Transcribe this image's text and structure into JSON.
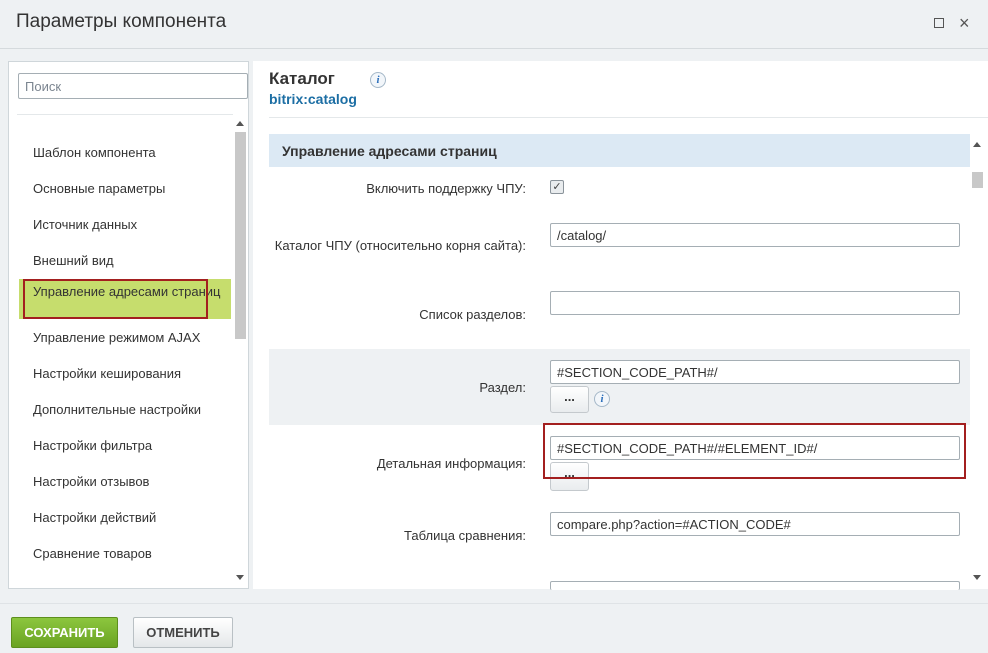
{
  "window": {
    "title": "Параметры компонента",
    "maximize_icon": "maximize-icon",
    "close_icon": "close-icon",
    "close_glyph": "×"
  },
  "sidebar": {
    "search_placeholder": "Поиск",
    "items": [
      {
        "label": "Шаблон компонента",
        "active": false
      },
      {
        "label": "Основные параметры",
        "active": false
      },
      {
        "label": "Источник данных",
        "active": false
      },
      {
        "label": "Внешний вид",
        "active": false
      },
      {
        "label": "Управление адресами страниц",
        "active": true
      },
      {
        "label": "Управление режимом AJAX",
        "active": false
      },
      {
        "label": "Настройки кеширования",
        "active": false
      },
      {
        "label": "Дополнительные настройки",
        "active": false
      },
      {
        "label": "Настройки фильтра",
        "active": false
      },
      {
        "label": "Настройки отзывов",
        "active": false
      },
      {
        "label": "Настройки действий",
        "active": false
      },
      {
        "label": "Сравнение товаров",
        "active": false
      }
    ]
  },
  "component": {
    "title": "Каталог",
    "code": "bitrix:catalog",
    "info_icon": "i"
  },
  "section": {
    "title": "Управление адресами страниц",
    "fields": [
      {
        "label": "Включить поддержку ЧПУ:",
        "type": "checkbox",
        "checked": true,
        "check_glyph": "✓"
      },
      {
        "label": "Каталог ЧПУ (относительно корня сайта):",
        "type": "text",
        "value": "/catalog/"
      },
      {
        "label": "Список разделов:",
        "type": "text",
        "value": ""
      },
      {
        "label": "Раздел:",
        "type": "text",
        "value": "#SECTION_CODE_PATH#/",
        "button": "...",
        "info": "i"
      },
      {
        "label": "Детальная информация:",
        "type": "text",
        "value": "#SECTION_CODE_PATH#/#ELEMENT_ID#/",
        "button": "..."
      },
      {
        "label": "Таблица сравнения:",
        "type": "text",
        "value": "compare.php?action=#ACTION_CODE#"
      }
    ]
  },
  "footer": {
    "save_label": "СОХРАНИТЬ",
    "cancel_label": "ОТМЕНИТЬ"
  },
  "colors": {
    "accent_green": "#7ab62f",
    "active_item_bg": "#c6dd6d",
    "highlight_border": "#a31f1f",
    "section_header_bg": "#dce9f4",
    "link_blue": "#1c6ea4"
  }
}
